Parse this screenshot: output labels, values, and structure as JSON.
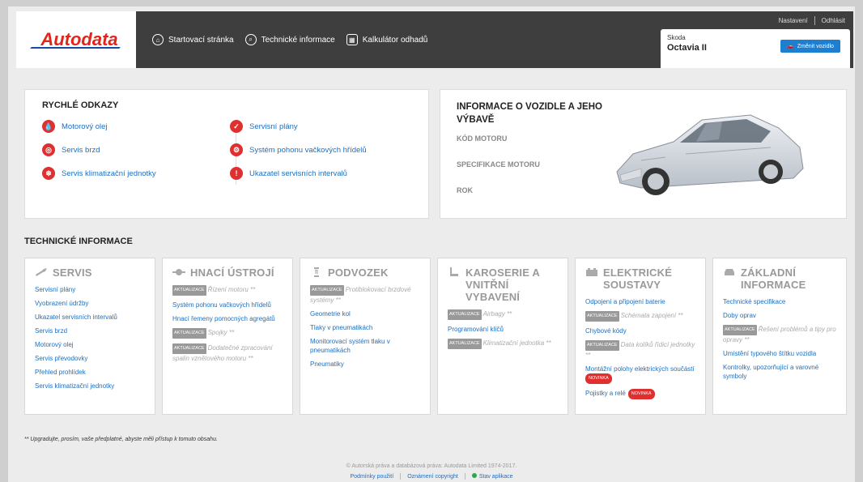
{
  "header": {
    "logo": "Autodata",
    "nav": [
      {
        "label": "Startovací stránka",
        "icon": "home-icon"
      },
      {
        "label": "Technické informace",
        "icon": "search-icon"
      },
      {
        "label": "Kalkulátor odhadů",
        "icon": "calculator-icon"
      }
    ],
    "settings": "Nastavení",
    "logout": "Odhlásit",
    "vehicle": {
      "make": "Skoda",
      "model": "Octavia II",
      "change": "Změnit vozidlo"
    }
  },
  "quick_links": {
    "title": "RYCHLÉ ODKAZY",
    "items": [
      {
        "label": "Motorový olej",
        "icon": "oil-drop-icon"
      },
      {
        "label": "Servis brzd",
        "icon": "brake-icon"
      },
      {
        "label": "Servis klimatizační jednotky",
        "icon": "snowflake-icon"
      },
      {
        "label": "Servisní plány",
        "icon": "checkmark-icon"
      },
      {
        "label": "Systém pohonu vačkových hřídelů",
        "icon": "camshaft-icon"
      },
      {
        "label": "Ukazatel servisních intervalů",
        "icon": "warning-icon"
      }
    ]
  },
  "vehicle_info": {
    "title": "INFORMACE O VOZIDLE A JEHO VÝBAVĚ",
    "engine_code": "KÓD MOTORU",
    "engine_spec": "SPECIFIKACE MOTORU",
    "year": "ROK"
  },
  "tech_info": {
    "title": "TECHNICKÉ INFORMACE",
    "badge_update": "AKTUALIZACE",
    "badge_new": "NOVINKA",
    "cards": [
      {
        "title": "SERVIS",
        "items": [
          "Servisní plány",
          "Vyobrazení údržby",
          "Ukazatel servisních intervalů",
          "Servis brzd",
          "Motorový olej",
          "Servis převodovky",
          "Přehled prohlídek",
          "Servis klimatizační jednotky"
        ]
      },
      {
        "title": "HNACÍ ÚSTROJÍ",
        "items": [
          {
            "text": "Řízení motoru **",
            "locked": true
          },
          {
            "text": "Systém pohonu vačkových hřídelů"
          },
          {
            "text": "Hnací řemeny pomocných agregátů"
          },
          {
            "text": "Spojky **",
            "locked": true
          },
          {
            "text": "Dodatečné zpracování spalin vznětového motoru **",
            "locked": true
          }
        ]
      },
      {
        "title": "PODVOZEK",
        "items": [
          {
            "text": "Protiblokovací brzdové systémy **",
            "locked": true
          },
          {
            "text": "Geometrie kol"
          },
          {
            "text": "Tlaky v pneumatikách"
          },
          {
            "text": "Monitorovací systém tlaku v pneumatikách"
          },
          {
            "text": "Pneumatiky"
          }
        ]
      },
      {
        "title": "KAROSERIE A VNITŘNÍ VYBAVENÍ",
        "items": [
          {
            "text": "Airbagy **",
            "locked": true
          },
          {
            "text": "Programování klíčů"
          },
          {
            "text": "Klimatizační jednotka **",
            "locked": true
          }
        ]
      },
      {
        "title": "ELEKTRICKÉ SOUSTAVY",
        "items": [
          {
            "text": "Odpojení a připojení baterie"
          },
          {
            "text": "Schémata zapojení **",
            "locked": true
          },
          {
            "text": "Chybové kódy"
          },
          {
            "text": "Data kolíků řídicí jednotky **",
            "locked": true
          },
          {
            "text": "Montážní polohy elektrických součástí",
            "new": true
          },
          {
            "text": "Pojistky a relé",
            "new": true
          }
        ]
      },
      {
        "title": "ZÁKLADNÍ INFORMACE",
        "items": [
          {
            "text": "Technické specifikace"
          },
          {
            "text": "Doby oprav"
          },
          {
            "text": "Řešení problémů a tipy pro opravy **",
            "locked": true
          },
          {
            "text": "Umístění typového štítku vozidla"
          },
          {
            "text": "Kontrolky, upozorňující a varovné symboly"
          }
        ]
      }
    ]
  },
  "footer": {
    "note": "** Upgradujte, prosím, vaše předplatné, abyste měli přístup k tomuto obsahu.",
    "copyright": "© Autorská práva a databázová práva: Autodata Limited 1974-2017.",
    "terms": "Podmínky použití",
    "copyright_notice": "Oznámení copyright",
    "app_status": "Stav aplikace"
  }
}
